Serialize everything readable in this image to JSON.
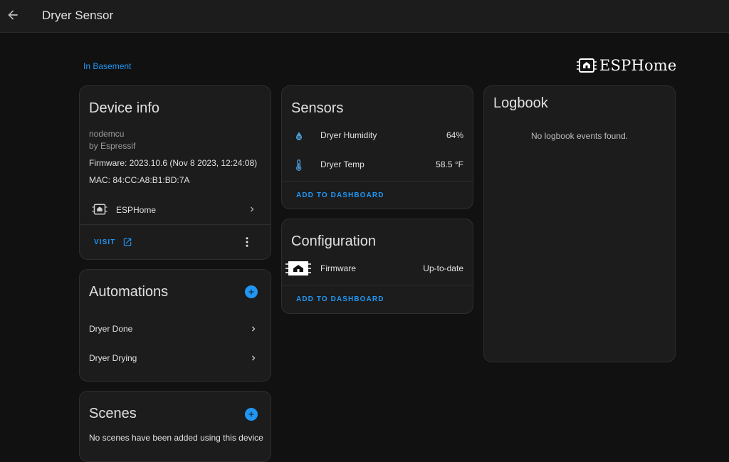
{
  "header": {
    "title": "Dryer Sensor",
    "back_icon": "arrow-left-icon"
  },
  "area": {
    "label": "In Basement"
  },
  "brand": {
    "name": "ESPHome",
    "icon": "esphome-chip-icon"
  },
  "device_info": {
    "title": "Device info",
    "model": "nodemcu",
    "manufacturer": "by Espressif",
    "firmware": "Firmware: 2023.10.6 (Nov 8 2023, 12:24:08)",
    "mac": "MAC: 84:CC:A8:B1:BD:7A",
    "integration": {
      "label": "ESPHome",
      "icon": "esphome-chip-icon"
    },
    "visit_label": "VISIT",
    "menu_icon": "dots-vertical-icon"
  },
  "automations": {
    "title": "Automations",
    "items": [
      {
        "label": "Dryer Done"
      },
      {
        "label": "Dryer Drying"
      }
    ]
  },
  "scenes": {
    "title": "Scenes",
    "empty_text": "No scenes have been added using this device"
  },
  "sensors": {
    "title": "Sensors",
    "items": [
      {
        "label": "Dryer Humidity",
        "value": "64%",
        "icon": "water-percent-icon"
      },
      {
        "label": "Dryer Temp",
        "value": "58.5 °F",
        "icon": "thermometer-icon"
      }
    ],
    "add_label": "ADD TO DASHBOARD"
  },
  "configuration": {
    "title": "Configuration",
    "items": [
      {
        "label": "Firmware",
        "value": "Up-to-date",
        "icon": "esphome-chip-icon"
      }
    ],
    "add_label": "ADD TO DASHBOARD"
  },
  "logbook": {
    "title": "Logbook",
    "empty_text": "No logbook events found."
  },
  "colors": {
    "accent": "#2196f3",
    "background": "#111111",
    "card": "#1c1c1c",
    "text": "#e1e1e1",
    "muted": "#9b9b9b"
  }
}
